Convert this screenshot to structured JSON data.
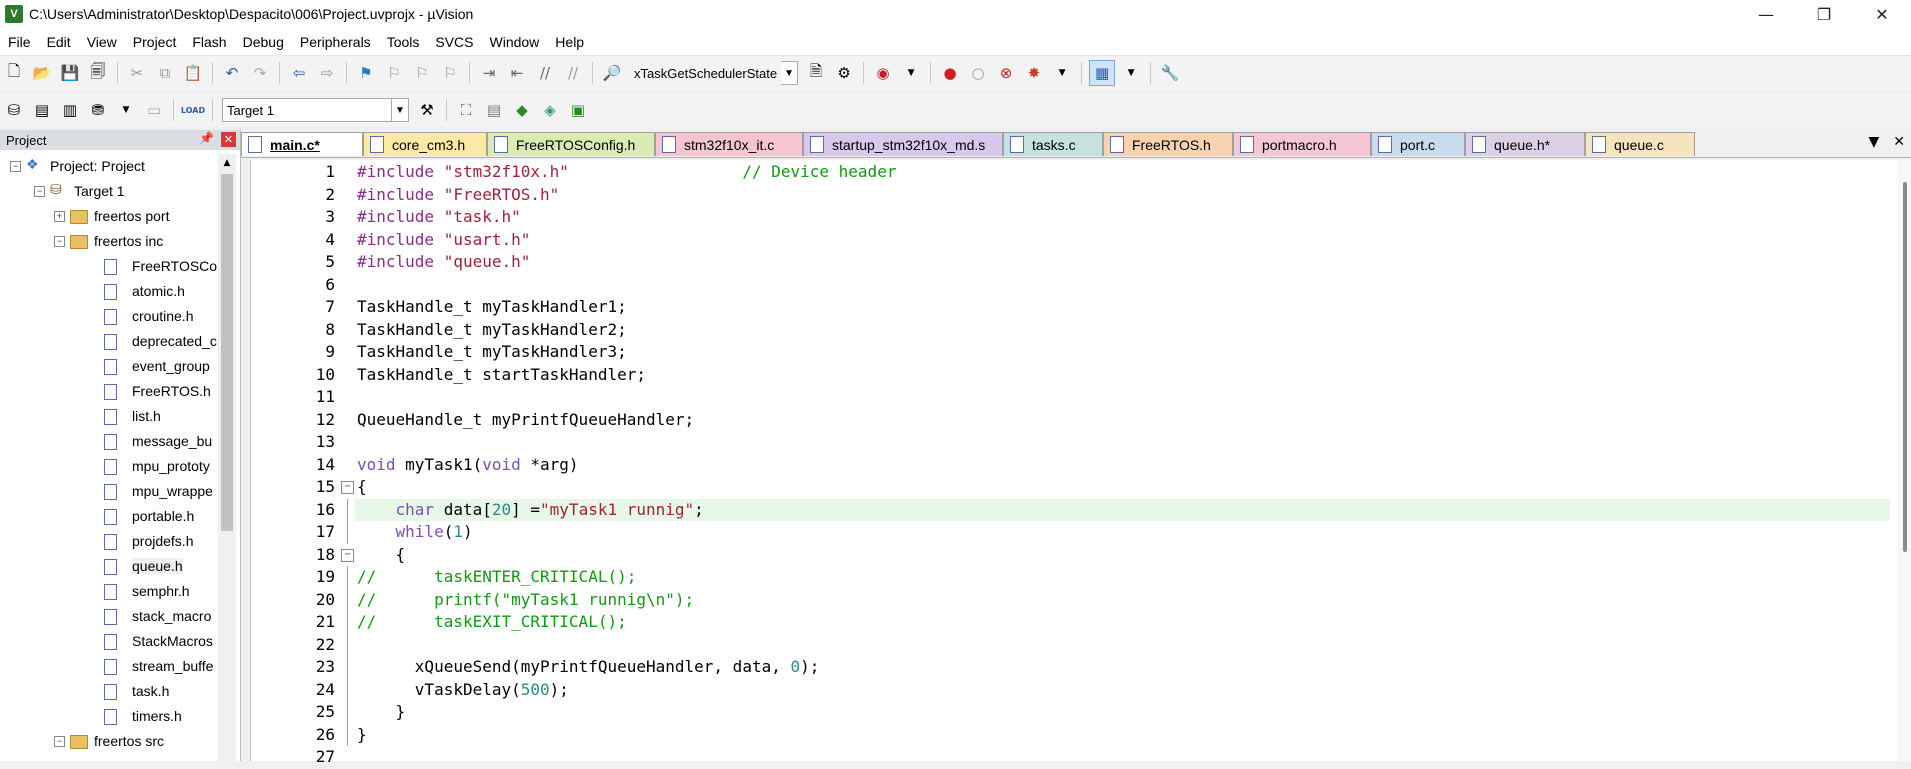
{
  "window": {
    "title": "C:\\Users\\Administrator\\Desktop\\Despacito\\006\\Project.uvprojx - µVision",
    "app_icon_letter": "V",
    "controls": {
      "minimize": "—",
      "maximize": "❐",
      "close": "✕"
    }
  },
  "menu": [
    "File",
    "Edit",
    "View",
    "Project",
    "Flash",
    "Debug",
    "Peripherals",
    "Tools",
    "SVCS",
    "Window",
    "Help"
  ],
  "toolbar1": {
    "find_combo_value": "xTaskGetSchedulerState"
  },
  "toolbar2": {
    "target_combo_value": "Target 1",
    "load_label": "LOAD"
  },
  "project_panel": {
    "title": "Project",
    "pin_icon": "pin-icon",
    "close_glyph": "✕",
    "tree": [
      {
        "label": "Project: Project",
        "level": 0,
        "type": "project",
        "expander": "−"
      },
      {
        "label": "Target 1",
        "level": 1,
        "type": "target",
        "expander": "−"
      },
      {
        "label": "freertos port",
        "level": 2,
        "type": "folder",
        "expander": "+"
      },
      {
        "label": "freertos inc",
        "level": 2,
        "type": "folder",
        "expander": "−"
      },
      {
        "label": "FreeRTOSCor",
        "level": 3,
        "type": "file"
      },
      {
        "label": "atomic.h",
        "level": 3,
        "type": "file"
      },
      {
        "label": "croutine.h",
        "level": 3,
        "type": "file"
      },
      {
        "label": "deprecated_c",
        "level": 3,
        "type": "file"
      },
      {
        "label": "event_group",
        "level": 3,
        "type": "file"
      },
      {
        "label": "FreeRTOS.h",
        "level": 3,
        "type": "file"
      },
      {
        "label": "list.h",
        "level": 3,
        "type": "file"
      },
      {
        "label": "message_bu",
        "level": 3,
        "type": "file"
      },
      {
        "label": "mpu_prototy",
        "level": 3,
        "type": "file"
      },
      {
        "label": "mpu_wrappe",
        "level": 3,
        "type": "file"
      },
      {
        "label": "portable.h",
        "level": 3,
        "type": "file"
      },
      {
        "label": "projdefs.h",
        "level": 3,
        "type": "file"
      },
      {
        "label": "queue.h",
        "level": 3,
        "type": "file",
        "selected": true
      },
      {
        "label": "semphr.h",
        "level": 3,
        "type": "file"
      },
      {
        "label": "stack_macro",
        "level": 3,
        "type": "file"
      },
      {
        "label": "StackMacros",
        "level": 3,
        "type": "file"
      },
      {
        "label": "stream_buffe",
        "level": 3,
        "type": "file"
      },
      {
        "label": "task.h",
        "level": 3,
        "type": "file"
      },
      {
        "label": "timers.h",
        "level": 3,
        "type": "file"
      },
      {
        "label": "freertos src",
        "level": 2,
        "type": "folder",
        "expander": "−"
      }
    ]
  },
  "tabs": [
    {
      "label": "main.c*",
      "color": "#ffffff",
      "active": true
    },
    {
      "label": "core_cm3.h",
      "color": "#fce9a6"
    },
    {
      "label": "FreeRTOSConfig.h",
      "color": "#d8ecb4"
    },
    {
      "label": "stm32f10x_it.c",
      "color": "#f5c6cf"
    },
    {
      "label": "startup_stm32f10x_md.s",
      "color": "#d8c8ec"
    },
    {
      "label": "tasks.c",
      "color": "#c6e2de"
    },
    {
      "label": "FreeRTOS.h",
      "color": "#f9d3b0"
    },
    {
      "label": "portmacro.h",
      "color": "#f5c6d4"
    },
    {
      "label": "port.c",
      "color": "#c9dcef"
    },
    {
      "label": "queue.h*",
      "color": "#dccfe8"
    },
    {
      "label": "queue.c",
      "color": "#f5e4bd"
    }
  ],
  "tab_nav": {
    "list": "▼",
    "close": "✕"
  },
  "code": [
    {
      "n": "1",
      "segs": [
        [
          "dir",
          "#include "
        ],
        [
          "str",
          "\"stm32f10x.h\""
        ],
        [
          "",
          "                  "
        ],
        [
          "com",
          "// Device header"
        ]
      ]
    },
    {
      "n": "2",
      "segs": [
        [
          "dir",
          "#include "
        ],
        [
          "str",
          "\"FreeRTOS.h\""
        ]
      ]
    },
    {
      "n": "3",
      "segs": [
        [
          "dir",
          "#include "
        ],
        [
          "str",
          "\"task.h\""
        ]
      ]
    },
    {
      "n": "4",
      "segs": [
        [
          "dir",
          "#include "
        ],
        [
          "str",
          "\"usart.h\""
        ]
      ]
    },
    {
      "n": "5",
      "segs": [
        [
          "dir",
          "#include "
        ],
        [
          "str",
          "\"queue.h\""
        ]
      ]
    },
    {
      "n": "6",
      "segs": []
    },
    {
      "n": "7",
      "segs": [
        [
          "",
          "TaskHandle_t myTaskHandler1;"
        ]
      ]
    },
    {
      "n": "8",
      "segs": [
        [
          "",
          "TaskHandle_t myTaskHandler2;"
        ]
      ]
    },
    {
      "n": "9",
      "segs": [
        [
          "",
          "TaskHandle_t myTaskHandler3;"
        ]
      ]
    },
    {
      "n": "10",
      "segs": [
        [
          "",
          "TaskHandle_t startTaskHandler;"
        ]
      ]
    },
    {
      "n": "11",
      "segs": []
    },
    {
      "n": "12",
      "segs": [
        [
          "",
          "QueueHandle_t myPrintfQueueHandler;"
        ]
      ]
    },
    {
      "n": "13",
      "segs": []
    },
    {
      "n": "14",
      "segs": [
        [
          "kw",
          "void"
        ],
        [
          "",
          " myTask1("
        ],
        [
          "kw",
          "void"
        ],
        [
          "",
          " *arg)"
        ]
      ]
    },
    {
      "n": "15",
      "fold": "−",
      "segs": [
        [
          "",
          "{"
        ]
      ]
    },
    {
      "n": "16",
      "hl": true,
      "segs": [
        [
          "",
          "    "
        ],
        [
          "kw",
          "char"
        ],
        [
          "",
          " data["
        ],
        [
          "num",
          "20"
        ],
        [
          "",
          "] ="
        ],
        [
          "str",
          "\"myTask1 runnig\""
        ],
        [
          "",
          ";"
        ]
      ]
    },
    {
      "n": "17",
      "segs": [
        [
          "",
          "    "
        ],
        [
          "kw",
          "while"
        ],
        [
          "",
          "("
        ],
        [
          "num",
          "1"
        ],
        [
          "",
          ")"
        ]
      ]
    },
    {
      "n": "18",
      "fold": "−",
      "segs": [
        [
          "",
          "    {"
        ]
      ]
    },
    {
      "n": "19",
      "segs": [
        [
          "com",
          "//      taskENTER_CRITICAL();"
        ]
      ]
    },
    {
      "n": "20",
      "segs": [
        [
          "com",
          "//      printf(\"myTask1 runnig\\n\");"
        ]
      ]
    },
    {
      "n": "21",
      "segs": [
        [
          "com",
          "//      taskEXIT_CRITICAL();"
        ]
      ]
    },
    {
      "n": "22",
      "segs": []
    },
    {
      "n": "23",
      "segs": [
        [
          "",
          "      xQueueSend(myPrintfQueueHandler, data, "
        ],
        [
          "num",
          "0"
        ],
        [
          "",
          ");"
        ]
      ]
    },
    {
      "n": "24",
      "segs": [
        [
          "",
          "      vTaskDelay("
        ],
        [
          "num",
          "500"
        ],
        [
          "",
          ");"
        ]
      ]
    },
    {
      "n": "25",
      "foldend": true,
      "segs": [
        [
          "",
          "    }"
        ]
      ]
    },
    {
      "n": "26",
      "foldend": true,
      "segs": [
        [
          "",
          "}"
        ]
      ]
    },
    {
      "n": "27",
      "segs": []
    }
  ]
}
